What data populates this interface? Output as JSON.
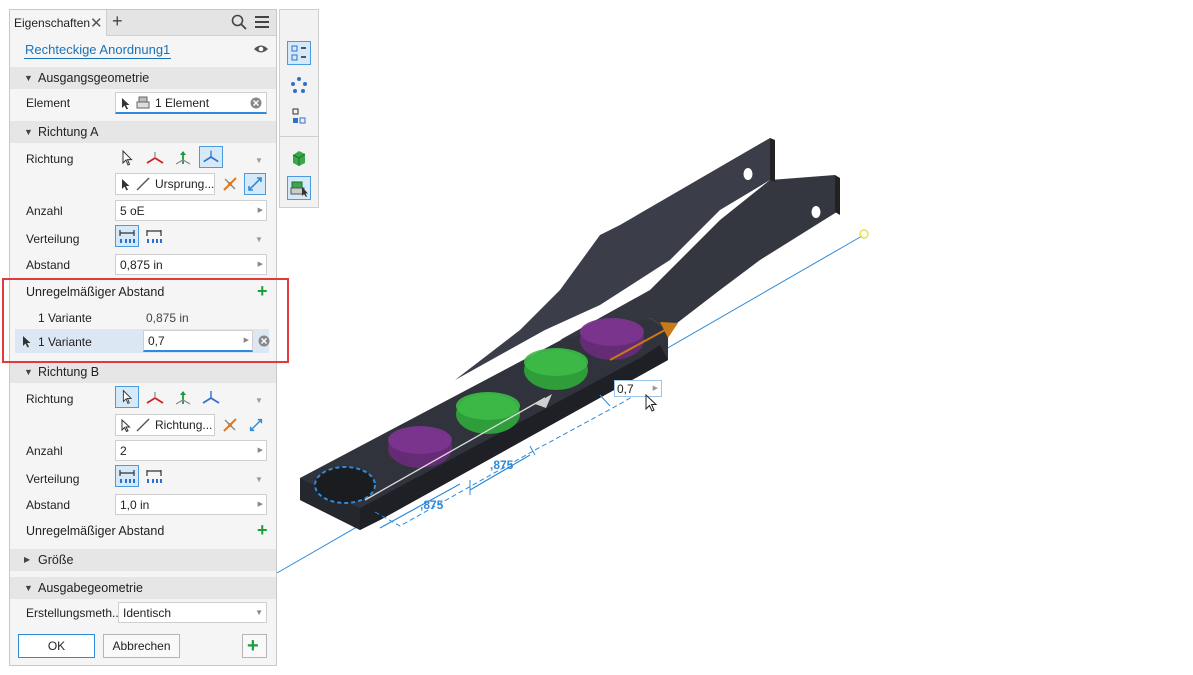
{
  "panel": {
    "tab_title": "Eigenschaften",
    "tab_close": "✕",
    "tab_add": "+",
    "feature_name": "Rechteckige Anordnung1"
  },
  "ausgangsgeometrie": {
    "header": "Ausgangsgeometrie",
    "element_label": "Element",
    "element_value": "1 Element"
  },
  "richtung_a": {
    "header": "Richtung A",
    "richtung_label": "Richtung",
    "direction_field": "Ursprung...",
    "anzahl_label": "Anzahl",
    "anzahl_value": "5 oE",
    "verteilung_label": "Verteilung",
    "abstand_label": "Abstand",
    "abstand_value": "0,875 in",
    "irregular_label": "Unregelmäßiger Abstand",
    "variants": [
      {
        "label": "1 Variante",
        "value": "0,875 in"
      },
      {
        "label": "1 Variante",
        "value": "0,7"
      }
    ]
  },
  "richtung_b": {
    "header": "Richtung B",
    "richtung_label": "Richtung",
    "direction_field": "Richtung...",
    "anzahl_label": "Anzahl",
    "anzahl_value": "2",
    "verteilung_label": "Verteilung",
    "abstand_label": "Abstand",
    "abstand_value": "1,0 in",
    "irregular_label": "Unregelmäßiger Abstand"
  },
  "groesse": {
    "header": "Größe"
  },
  "ausgabegeometrie": {
    "header": "Ausgabegeometrie",
    "method_label": "Erstellungsmeth...",
    "method_value": "Identisch"
  },
  "buttons": {
    "ok": "OK",
    "cancel": "Abbrechen"
  },
  "viewport": {
    "dim_label_1": ",875",
    "dim_label_2": ",875",
    "input_value": "0,7"
  },
  "colors": {
    "accent": "#2f8ad9",
    "link": "#1a73b8",
    "highlight_box": "#e23a3a",
    "add_green": "#1e9e3c",
    "part_body": "#3b3e48",
    "feature_purple": "#6b2a7a",
    "feature_green": "#2fa93a"
  }
}
